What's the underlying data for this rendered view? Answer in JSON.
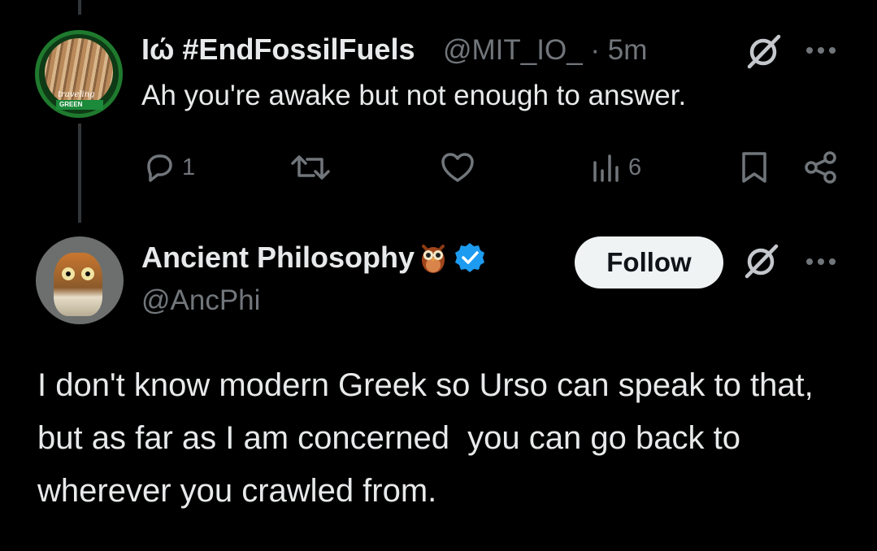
{
  "tweet1": {
    "display_name": "Ιώ #EndFossilFuels",
    "handle": "@MIT_IO_",
    "separator": "·",
    "time": "5m",
    "text": "Ah you're awake but not enough to answer.",
    "avatar_text_cursive": "traveling",
    "avatar_text_banner": "GREEN",
    "replies": "1",
    "views": "6",
    "icons": [
      "grok-icon",
      "more-icon",
      "reply-icon",
      "retweet-icon",
      "like-icon",
      "views-icon",
      "bookmark-icon",
      "share-icon"
    ]
  },
  "tweet2": {
    "display_name": "Ancient Philosophy",
    "handle": "@AncPhi",
    "follow_label": "Follow",
    "text": "I don't know modern Greek so Urso can speak to that, but as far as I am concerned  you can go back to wherever you crawled from.",
    "icons": [
      "owl-emoji-icon",
      "verified-icon",
      "grok-icon",
      "more-icon"
    ]
  },
  "colors": {
    "background": "#000000",
    "text": "#e7e9ea",
    "secondary": "#71767b",
    "verified": "#1d9bf0",
    "thread_line": "#333639",
    "follow_bg": "#eff3f4"
  }
}
